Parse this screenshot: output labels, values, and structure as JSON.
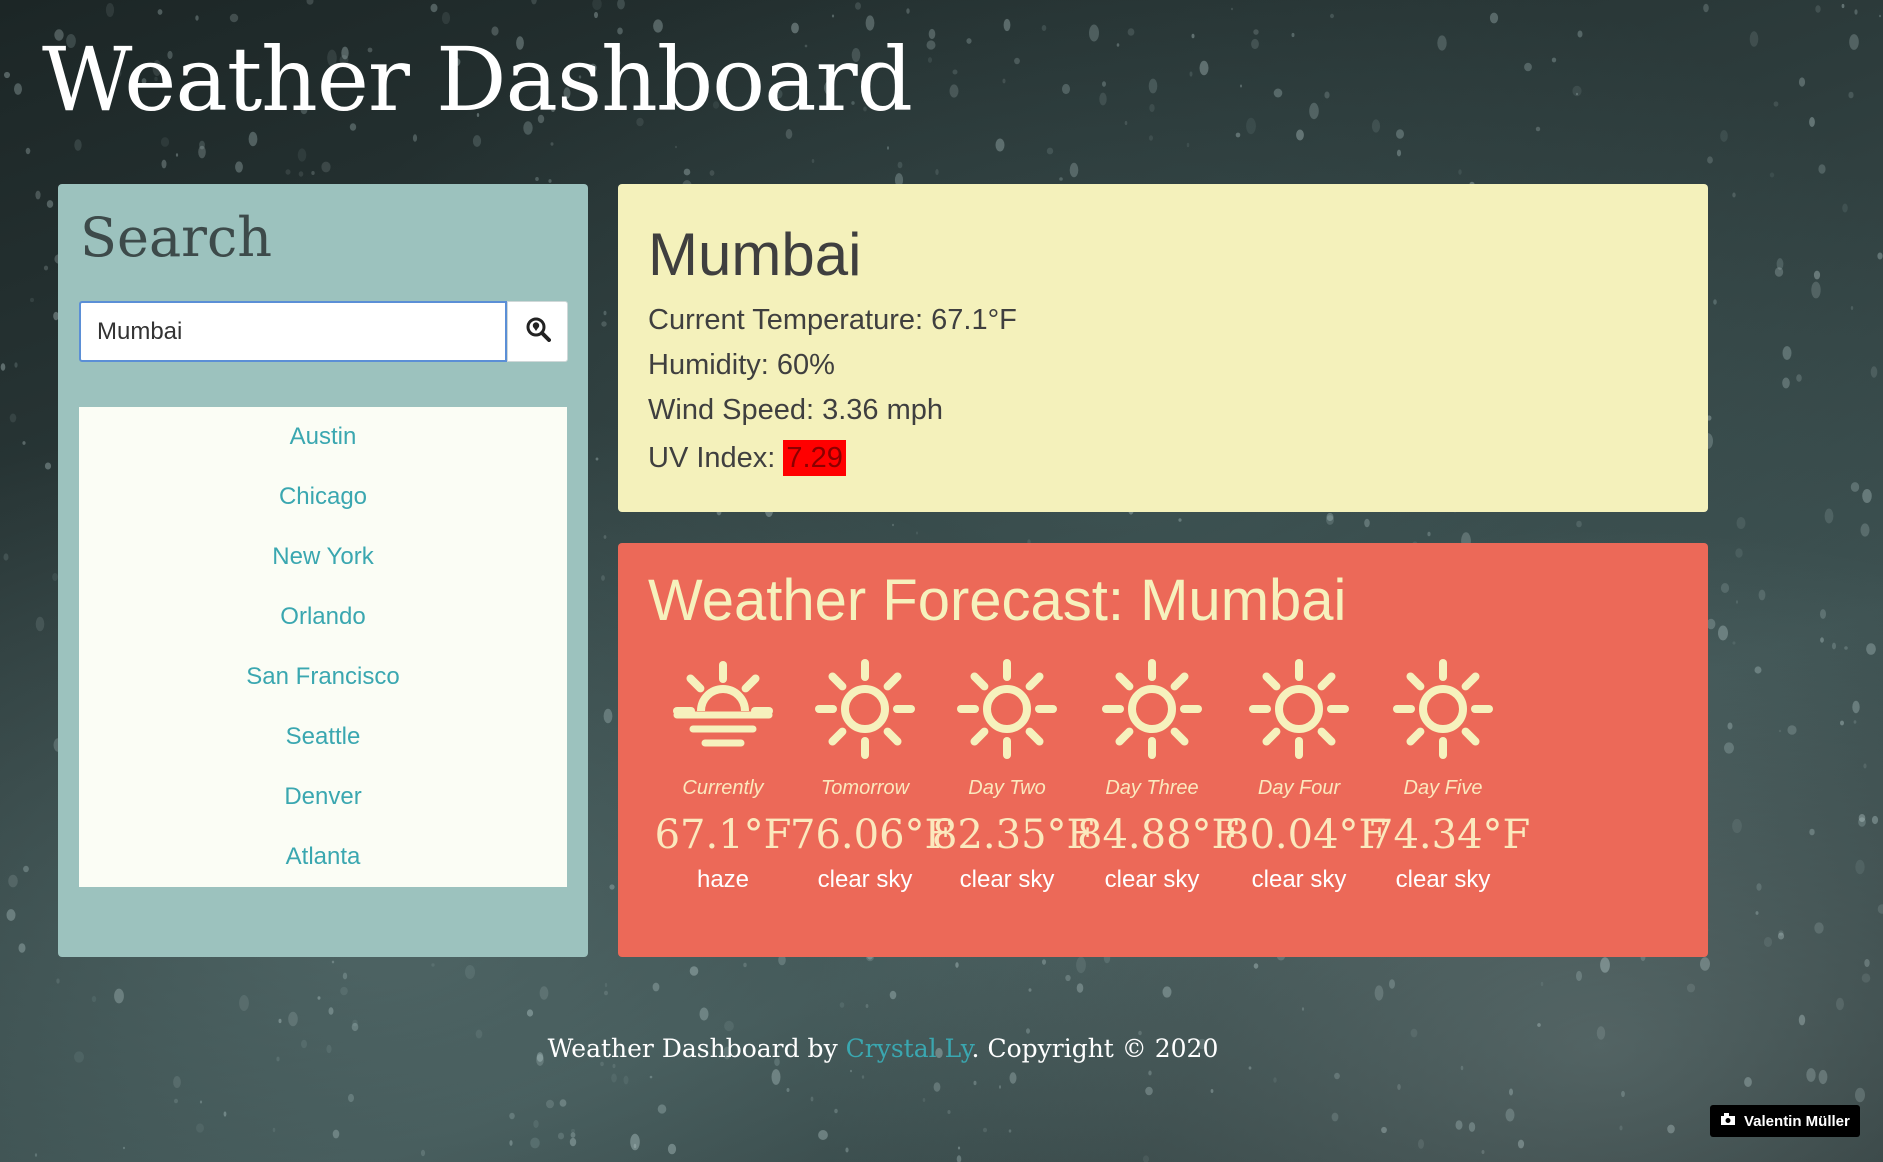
{
  "page": {
    "title": "Weather Dashboard"
  },
  "search": {
    "heading": "Search",
    "input_value": "Mumbai",
    "button_icon": "search-location-icon"
  },
  "cities": [
    "Austin",
    "Chicago",
    "New York",
    "Orlando",
    "San Francisco",
    "Seattle",
    "Denver",
    "Atlanta"
  ],
  "current": {
    "city": "Mumbai",
    "temperature": "Current Temperature: 67.1°F",
    "humidity": "Humidity: 60%",
    "wind": "Wind Speed: 3.36 mph",
    "uv_label": "UV Index: ",
    "uv_value": "7.29"
  },
  "forecast": {
    "title": "Weather Forecast: Mumbai",
    "days": [
      {
        "label": "Currently",
        "temp": "67.1°F",
        "desc": "haze",
        "icon": "sunrise-icon"
      },
      {
        "label": "Tomorrow",
        "temp": "76.06°F",
        "desc": "clear sky",
        "icon": "sun-icon"
      },
      {
        "label": "Day Two",
        "temp": "82.35°F",
        "desc": "clear sky",
        "icon": "sun-icon"
      },
      {
        "label": "Day Three",
        "temp": "84.88°F",
        "desc": "clear sky",
        "icon": "sun-icon"
      },
      {
        "label": "Day Four",
        "temp": "80.04°F",
        "desc": "clear sky",
        "icon": "sun-icon"
      },
      {
        "label": "Day Five",
        "temp": "74.34°F",
        "desc": "clear sky",
        "icon": "sun-icon"
      }
    ]
  },
  "footer": {
    "prefix": "Weather Dashboard by ",
    "author": "Crystal Ly",
    "suffix": ". Copyright © 2020"
  },
  "photo_credit": "Valentin Müller",
  "colors": {
    "search_panel": "#9cc2be",
    "current_card": "#f4f1bb",
    "forecast_card": "#ec6958",
    "accent_link": "#3aa7b0",
    "uv_badge": "#ff0000"
  }
}
